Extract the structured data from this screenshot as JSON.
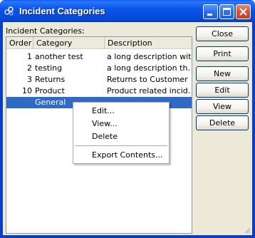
{
  "window": {
    "title": "Incident Categories",
    "icon": "app-icon",
    "controls": [
      "minimize-icon",
      "maximize-icon",
      "close-icon"
    ]
  },
  "list": {
    "label": "Incident Categories:",
    "columns": [
      "Order",
      "Category",
      "Description"
    ],
    "rows": [
      {
        "order": "1",
        "category": "another test",
        "description": "a long description with"
      },
      {
        "order": "2",
        "category": "testing",
        "description": "a long description th…"
      },
      {
        "order": "3",
        "category": "Returns",
        "description": "Returns to Customer"
      },
      {
        "order": "10",
        "category": "Product",
        "description": "Product related incid…"
      },
      {
        "order": "",
        "category": "General",
        "description": ""
      }
    ],
    "selected_row": 4
  },
  "buttons": {
    "close": "Close",
    "print": "Print",
    "new": "New",
    "edit": "Edit",
    "view": "View",
    "delete": "Delete"
  },
  "context_menu": {
    "items": [
      "Edit...",
      "View...",
      "Delete",
      "Export Contents..."
    ]
  },
  "colors": {
    "titlebar": "#0a55ea",
    "selection": "#316ac5",
    "dialog_bg": "#ece9d8",
    "button_border": "#003c74"
  }
}
